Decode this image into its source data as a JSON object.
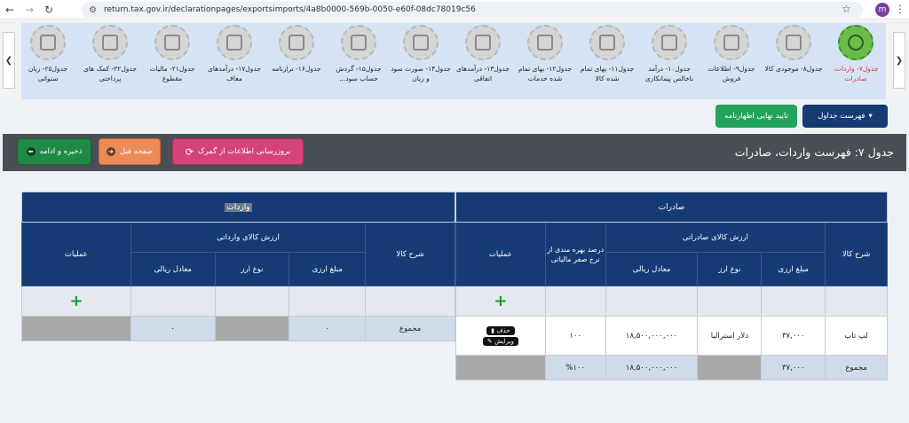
{
  "browser": {
    "url": "return.tax.gov.ir/declarationpages/exportsimports/4a8b0000-569b-0050-e60f-08dc78019c56",
    "profile_initial": "m"
  },
  "carousel": {
    "items": [
      {
        "label": "جدول۷- واردات، صادرات",
        "icon": "currency-exchange-icon",
        "active": true
      },
      {
        "label": "جدول۸- موجودی کالا",
        "icon": "inventory-icon"
      },
      {
        "label": "جدول۹- اطلاعات فروش",
        "icon": "sales-icon"
      },
      {
        "label": "جدول۱۰- درآمد ناخالص پیمانکاری",
        "icon": "contract-income-icon"
      },
      {
        "label": "جدول۱۱- بهای تمام شده کالا",
        "icon": "goods-cost-icon"
      },
      {
        "label": "جدول۱۲- بهای تمام شده خدمات",
        "icon": "services-cost-icon"
      },
      {
        "label": "جدول۱۳- درآمدهای اتفاقی",
        "icon": "incidental-income-icon"
      },
      {
        "label": "جدول۱۴- صورت سود و زیان",
        "icon": "profit-loss-icon"
      },
      {
        "label": "جدول۱۵- گردش حساب سود...",
        "icon": "profit-account-icon"
      },
      {
        "label": "جدول۱۶- ترازنامه",
        "icon": "balance-sheet-icon"
      },
      {
        "label": "جدول۱۷- درآمدهای معاف",
        "icon": "exempt-income-icon"
      },
      {
        "label": "جدول۲۱- مالیات مقطوع",
        "icon": "fixed-tax-icon"
      },
      {
        "label": "جدول۲۲- کمک های پرداختی",
        "icon": "donations-icon"
      },
      {
        "label": "جدول۲۵- زیان سنواتی",
        "icon": "prior-losses-icon"
      }
    ]
  },
  "actions": {
    "table_list": "فهرست جداول",
    "final_confirm": "تایید نهایی اظهارنامه"
  },
  "title": "جدول ۷: فهرست واردات، صادرات",
  "toolbar": {
    "update": "بروزرسانی اطلاعات از گمرک",
    "prev": "صفحه قبل",
    "save": "ذخیره و ادامه"
  },
  "exports": {
    "title": "صادرات",
    "headers": {
      "desc": "شرح کالا",
      "value_group": "ارزش کالای صادراتی",
      "fx_amount": "مبلغ ارزی",
      "currency": "نوع ارز",
      "rial": "معادل ریالی",
      "zero_rate": "درصد بهره مندی از نرخ صفر مالیاتی",
      "ops": "عملیات"
    },
    "row": {
      "desc": "لپ تاپ",
      "fx_amount": "۳۷,۰۰۰",
      "currency": "دلار استرالیا",
      "rial": "۱۸,۵۰۰,۰۰۰,۰۰۰",
      "zero_rate": "۱۰۰",
      "delete": "حذف",
      "edit": "ویرایش"
    },
    "total": {
      "label": "مجموع",
      "fx_amount": "۳۷,۰۰۰",
      "rial": "۱۸,۵۰۰,۰۰۰,۰۰۰",
      "zero_rate": "%۱۰۰"
    }
  },
  "imports": {
    "title": "واردات",
    "headers": {
      "desc": "شرح کالا",
      "value_group": "ارزش کالای وارداتی",
      "fx_amount": "مبلغ ارزی",
      "currency": "نوع ارز",
      "rial": "معادل ریالی",
      "ops": "عملیات"
    },
    "total": {
      "label": "مجموع",
      "fx_amount": "۰",
      "rial": "۰"
    }
  },
  "add_symbol": "+"
}
